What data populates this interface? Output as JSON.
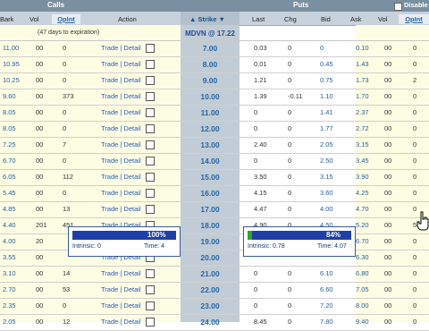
{
  "header": {
    "calls_title": "Calls",
    "puts_title": "Puts",
    "disable_label": "Disable",
    "columns": {
      "bark": "Bark",
      "vol_calls": "Vol",
      "opint_calls": "OpInt",
      "action": "Action",
      "strike": "Strike",
      "last": "Last",
      "chg": "Chg",
      "bid": "Bid",
      "ask": "Ask",
      "vol_puts": "Vol",
      "opint_puts": "OpInt"
    },
    "sort_arrow_up": "▲",
    "sort_arrow_down": "▼"
  },
  "expiration_text": "(47 days to expiration)",
  "quote": "MDVN @ 17.22",
  "trade_link": "Trade | Detail",
  "rows": [
    {
      "bark": "11.00",
      "vol": "00",
      "opint": "0",
      "strike": "7.00",
      "last": "0.03",
      "chg": "0",
      "bid": "0",
      "ask": "0.10",
      "pvol": "00",
      "popint": "0"
    },
    {
      "bark": "10.95",
      "vol": "00",
      "opint": "0",
      "strike": "8.00",
      "last": "0.01",
      "chg": "0",
      "bid": "0.45",
      "ask": "1.43",
      "pvol": "00",
      "popint": "0"
    },
    {
      "bark": "10.25",
      "vol": "00",
      "opint": "0",
      "strike": "9.00",
      "last": "1.21",
      "chg": "0",
      "bid": "0.75",
      "ask": "1.73",
      "pvol": "00",
      "popint": "2"
    },
    {
      "bark": "9.60",
      "vol": "00",
      "opint": "373",
      "strike": "10.00",
      "last": "1.39",
      "chg": "-0.11",
      "bid": "1.10",
      "ask": "1.70",
      "pvol": "00",
      "popint": "0"
    },
    {
      "bark": "8.05",
      "vol": "00",
      "opint": "0",
      "strike": "11.00",
      "last": "0",
      "chg": "0",
      "bid": "1.41",
      "ask": "2.37",
      "pvol": "00",
      "popint": "0"
    },
    {
      "bark": "8.05",
      "vol": "00",
      "opint": "0",
      "strike": "12.00",
      "last": "0",
      "chg": "0",
      "bid": "1.77",
      "ask": "2.72",
      "pvol": "00",
      "popint": "0"
    },
    {
      "bark": "7.25",
      "vol": "00",
      "opint": "7",
      "strike": "13.00",
      "last": "2.40",
      "chg": "0",
      "bid": "2.05",
      "ask": "3.15",
      "pvol": "00",
      "popint": "0"
    },
    {
      "bark": "6.70",
      "vol": "00",
      "opint": "0",
      "strike": "14.00",
      "last": "0",
      "chg": "0",
      "bid": "2.50",
      "ask": "3.45",
      "pvol": "00",
      "popint": "0"
    },
    {
      "bark": "6.05",
      "vol": "00",
      "opint": "112",
      "strike": "15.00",
      "last": "3.50",
      "chg": "0",
      "bid": "3.15",
      "ask": "3.90",
      "pvol": "00",
      "popint": "0"
    },
    {
      "bark": "5.45",
      "vol": "00",
      "opint": "0",
      "strike": "16.00",
      "last": "4.15",
      "chg": "0",
      "bid": "3.60",
      "ask": "4.25",
      "pvol": "00",
      "popint": "0"
    },
    {
      "bark": "4.85",
      "vol": "00",
      "opint": "13",
      "strike": "17.00",
      "last": "4.47",
      "chg": "0",
      "bid": "4.00",
      "ask": "4.70",
      "pvol": "00",
      "popint": "0"
    },
    {
      "bark": "4.40",
      "vol": "201",
      "opint": "451",
      "strike": "18.00",
      "last": "4.90",
      "chg": "0",
      "bid": "4.50",
      "ask": "5.20",
      "pvol": "00",
      "popint": "50"
    },
    {
      "bark": "4.00",
      "vol": "20",
      "opint": "",
      "strike": "19.00",
      "last": "",
      "chg": "",
      "bid": "",
      "ask": "6.70",
      "pvol": "00",
      "popint": "0"
    },
    {
      "bark": "3.55",
      "vol": "00",
      "opint": "",
      "strike": "20.00",
      "last": "",
      "chg": "",
      "bid": "",
      "ask": "6.30",
      "pvol": "00",
      "popint": "0"
    },
    {
      "bark": "3.10",
      "vol": "00",
      "opint": "14",
      "strike": "21.00",
      "last": "0",
      "chg": "0",
      "bid": "6.10",
      "ask": "6.80",
      "pvol": "00",
      "popint": "0"
    },
    {
      "bark": "2.70",
      "vol": "00",
      "opint": "53",
      "strike": "22.00",
      "last": "0",
      "chg": "0",
      "bid": "6.60",
      "ask": "7.05",
      "pvol": "00",
      "popint": "0"
    },
    {
      "bark": "2.35",
      "vol": "00",
      "opint": "0",
      "strike": "23.00",
      "last": "0",
      "chg": "0",
      "bid": "7.20",
      "ask": "8.00",
      "pvol": "00",
      "popint": "0"
    },
    {
      "bark": "2.05",
      "vol": "00",
      "opint": "12",
      "strike": "24.00",
      "last": "8.45",
      "chg": "0",
      "bid": "7.80",
      "ask": "9.40",
      "pvol": "00",
      "popint": "0"
    }
  ],
  "call_tooltip": {
    "pct": "100%",
    "pct_value": 1.0,
    "intrinsic": "Intrinsic: 0",
    "time": "Time: 4"
  },
  "put_tooltip": {
    "pct": "84%",
    "pct_value": 0.84,
    "intrinsic": "Intrinsic: 0.78",
    "time": "Time: 4.07"
  },
  "colors": {
    "header": "#7a8fa0",
    "subheader": "#c8d2dc",
    "strike_col": "#c2ccd6",
    "link": "#2a5bb8",
    "bar": "#1f3fa8",
    "bar_green": "#2fa52f"
  }
}
